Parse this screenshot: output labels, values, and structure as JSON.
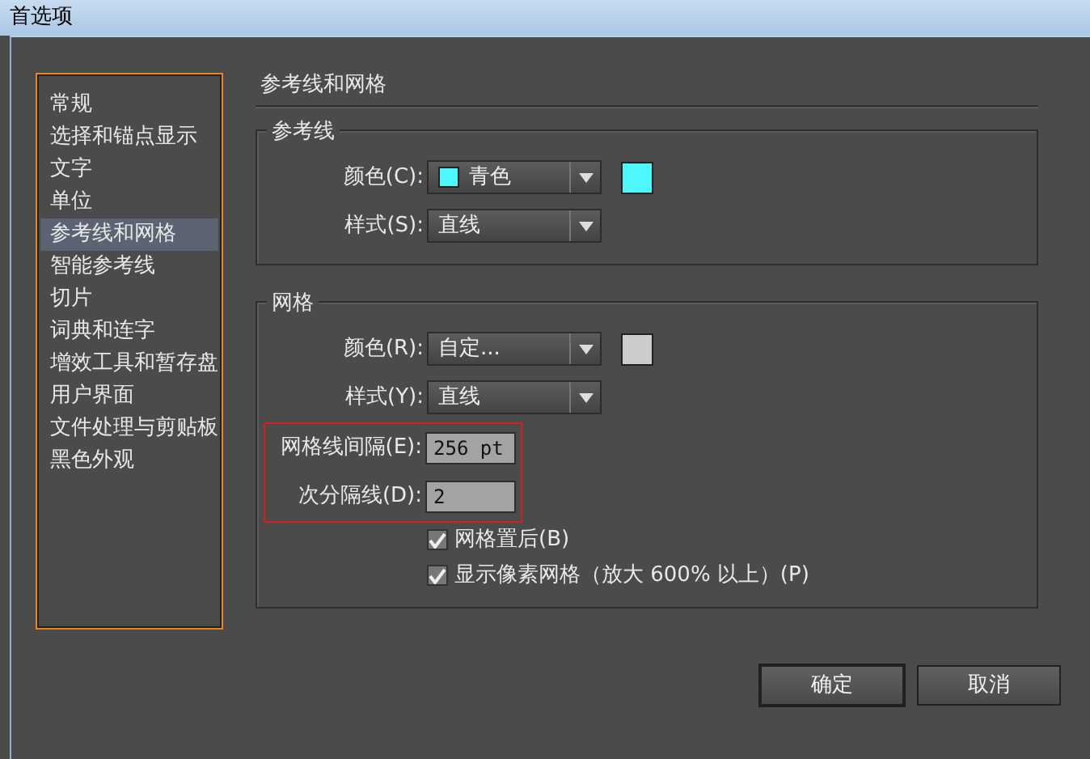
{
  "window": {
    "title": "首选项"
  },
  "sidebar": {
    "items": [
      {
        "label": "常规",
        "selected": false
      },
      {
        "label": "选择和锚点显示",
        "selected": false
      },
      {
        "label": "文字",
        "selected": false
      },
      {
        "label": "单位",
        "selected": false
      },
      {
        "label": "参考线和网格",
        "selected": true
      },
      {
        "label": "智能参考线",
        "selected": false
      },
      {
        "label": "切片",
        "selected": false
      },
      {
        "label": "词典和连字",
        "selected": false
      },
      {
        "label": "增效工具和暂存盘",
        "selected": false
      },
      {
        "label": "用户界面",
        "selected": false
      },
      {
        "label": "文件处理与剪贴板",
        "selected": false
      },
      {
        "label": "黑色外观",
        "selected": false
      }
    ]
  },
  "panel_title": "参考线和网格",
  "groups": [
    {
      "title": "参考线",
      "rows": [
        {
          "kind": "select",
          "label": "颜色(C):",
          "value": "青色",
          "menu_swatch": {
            "color": "#4ff7fc"
          },
          "swatch": {
            "color": "#4ff7fc"
          }
        },
        {
          "kind": "select",
          "label": "样式(S):",
          "value": "直线"
        }
      ]
    },
    {
      "title": "网格",
      "rows": [
        {
          "kind": "select",
          "label": "颜色(R):",
          "value": "自定...",
          "swatch": {
            "color": "#cccccc"
          }
        },
        {
          "kind": "select",
          "label": "样式(Y):",
          "value": "直线"
        },
        {
          "kind": "input",
          "label": "网格线间隔(E):",
          "value": "256 pt",
          "highlighted": true
        },
        {
          "kind": "input",
          "label": "次分隔线(D):",
          "value": "2",
          "highlighted": true
        },
        {
          "kind": "checkbox",
          "label": "网格置后(B)",
          "checked": true
        },
        {
          "kind": "checkbox",
          "label": "显示像素网格（放大 600% 以上）(P)",
          "checked": true
        }
      ]
    }
  ],
  "buttons": [
    {
      "label": "确定",
      "default": true
    },
    {
      "label": "取消",
      "default": false
    }
  ]
}
